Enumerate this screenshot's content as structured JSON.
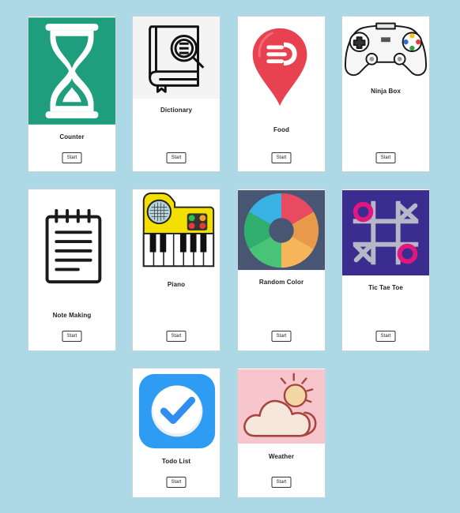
{
  "apps": [
    {
      "title": "Counter",
      "button": "Start",
      "icon": "hourglass-icon"
    },
    {
      "title": "Dictionary",
      "button": "Start",
      "icon": "dictionary-book-icon"
    },
    {
      "title": "Food",
      "button": "Start",
      "icon": "food-pin-icon"
    },
    {
      "title": "Ninja Box",
      "button": "Start",
      "icon": "gamepad-icon"
    },
    {
      "title": "Note Making",
      "button": "Start",
      "icon": "notepad-icon"
    },
    {
      "title": "Piano",
      "button": "Start",
      "icon": "piano-icon"
    },
    {
      "title": "Random Color",
      "button": "Start",
      "icon": "color-wheel-icon"
    },
    {
      "title": "Tic Tae Toe",
      "button": "Start",
      "icon": "tic-tac-toe-icon"
    },
    {
      "title": "Todo List",
      "button": "Start",
      "icon": "checkmark-icon"
    },
    {
      "title": "Weather",
      "button": "Start",
      "icon": "weather-cloud-sun-icon"
    }
  ],
  "colors": {
    "page_background": "#add8e6",
    "counter_green": "#1f9e7e",
    "food_red": "#e8414f",
    "piano_yellow": "#f4e000",
    "tictactoe_purple": "#3a2d8f",
    "tictactoe_pink": "#e2167f",
    "todo_blue": "#2f9cf4",
    "weather_pink": "#f6c6cc"
  }
}
